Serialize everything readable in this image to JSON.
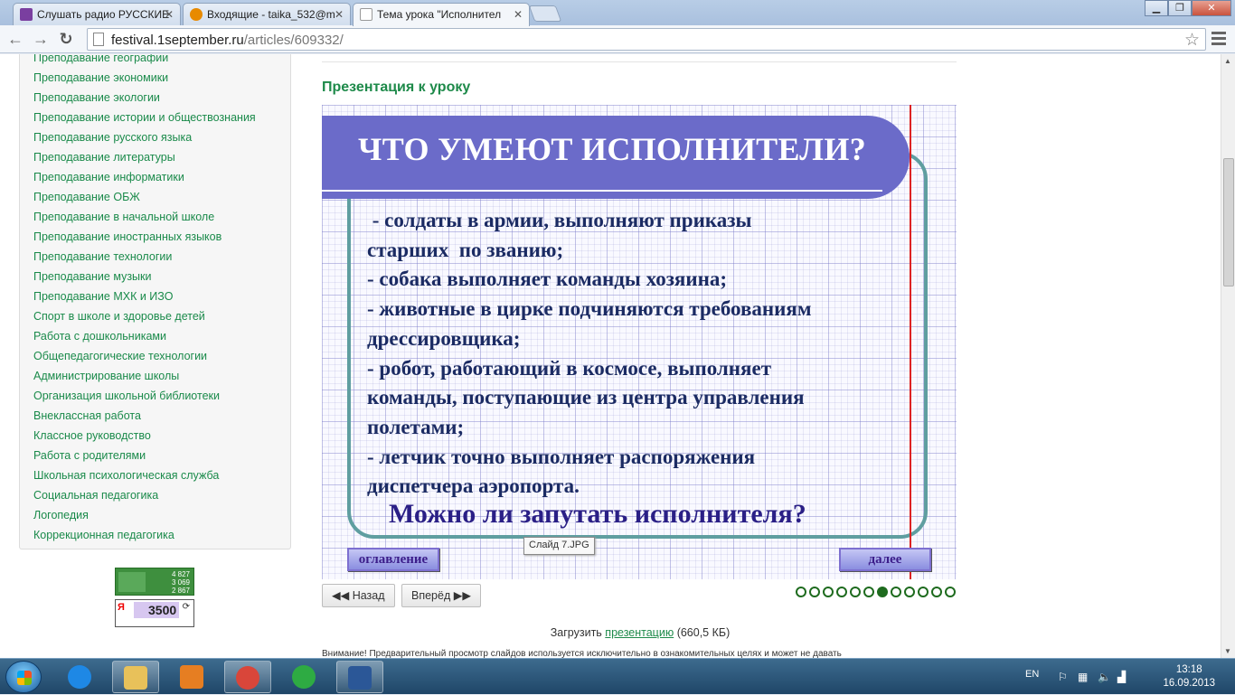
{
  "tabs": [
    {
      "label": "Слушать радио РУССКИЕ",
      "favicon_color": "#c0392b"
    },
    {
      "label": "Входящие - taika_532@m",
      "favicon_color": "#e88a00"
    },
    {
      "label": "Тема урока \"Исполнител",
      "favicon_color": "#ffffff"
    }
  ],
  "address": {
    "host": "festival.1september.ru",
    "path": "/articles/609332/"
  },
  "sidebar": {
    "items": [
      "Преподавание географии",
      "Преподавание экономики",
      "Преподавание экологии",
      "Преподавание истории и обществознания",
      "Преподавание русского языка",
      "Преподавание литературы",
      "Преподавание информатики",
      "Преподавание ОБЖ",
      "Преподавание в начальной школе",
      "Преподавание иностранных языков",
      "Преподавание технологии",
      "Преподавание музыки",
      "Преподавание МХК и ИЗО",
      "Спорт в школе и здоровье детей",
      "Работа с дошкольниками",
      "Общепедагогические технологии",
      "Администрирование школы",
      "Организация школьной библиотеки",
      "Внеклассная работа",
      "Классное руководство",
      "Работа с родителями",
      "Школьная психологическая служба",
      "Социальная педагогика",
      "Логопедия",
      "Коррекционная педагогика"
    ]
  },
  "counters": {
    "liveinternet": [
      "4 827",
      "3 069",
      "2 867"
    ],
    "yandex": {
      "logo": "Я",
      "value": "3500"
    }
  },
  "main": {
    "section_title": "Презентация к уроку",
    "slide": {
      "heading": "ЧТО УМЕЮТ ИСПОЛНИТЕЛИ?",
      "lines": [
        " - солдаты в армии, выполняют приказы",
        "старших  по званию;",
        "- собака выполняет команды хозяина;",
        "- животные в цирке подчиняются требованиям",
        "дрессировщика;",
        "- робот, работающий в космосе, выполняет",
        "команды, поступающие из центра управления",
        "полетами;",
        "- летчик точно выполняет распоряжения",
        "диспетчера аэропорта."
      ],
      "question": "Можно ли запутать исполнителя?",
      "btn_contents": "оглавление",
      "btn_next": "далее",
      "tooltip": "Слайд 7.JPG"
    },
    "pager": {
      "prev_label": "Назад",
      "next_label": "Вперёд",
      "dot_count": 12,
      "active_dot": 7
    },
    "download": {
      "prefix": "Загрузить",
      "link": "презентацию",
      "size": "(660,5 КБ)"
    },
    "note": "Внимание! Предварительный просмотр слайдов используется исключительно в ознакомительных целях и может не давать"
  },
  "taskbar": {
    "lang": "EN",
    "time": "13:18",
    "date": "16.09.2013",
    "apps": [
      {
        "name": "internet-explorer",
        "color": "#1e88e5",
        "open": false
      },
      {
        "name": "file-explorer",
        "color": "#e8c15a",
        "open": true
      },
      {
        "name": "media-player",
        "color": "#e67e22",
        "open": false
      },
      {
        "name": "chrome",
        "color": "#d9463a",
        "open": true
      },
      {
        "name": "mail-agent",
        "color": "#2eab43",
        "open": false
      },
      {
        "name": "word",
        "color": "#2b5797",
        "open": true
      }
    ]
  }
}
